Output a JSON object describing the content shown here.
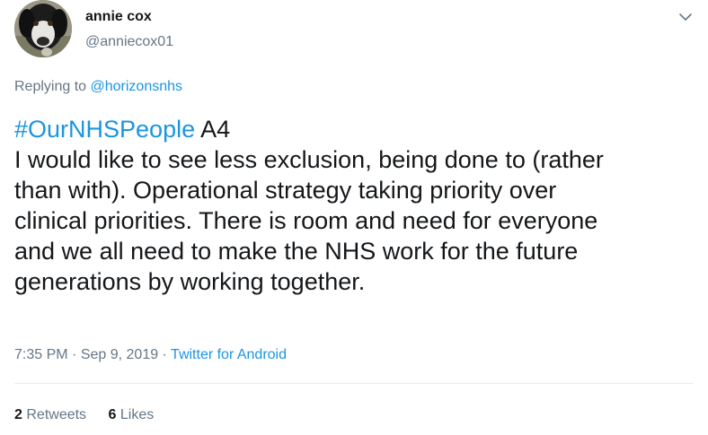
{
  "author": {
    "display_name": "annie cox",
    "handle": "@anniecox01",
    "avatar_icon": "dog-avatar"
  },
  "reply": {
    "prefix": "Replying to",
    "mention": "@horizonsnhs"
  },
  "tweet": {
    "hashtag": "#OurNHSPeople",
    "after_hashtag": " A4",
    "lines": [
      "I would like to see less exclusion, being done to (rather",
      "than with). Operational strategy taking priority over",
      "clinical priorities. There is room and need for everyone",
      "and we all need to make the NHS work for the future",
      "generations by working together."
    ]
  },
  "meta": {
    "time": "7:35 PM",
    "sep1": " · ",
    "date": "Sep 9, 2019",
    "sep2": " · ",
    "source": "Twitter for Android"
  },
  "stats": {
    "retweets_count": "2",
    "retweets_label": "Retweets",
    "likes_count": "6",
    "likes_label": "Likes"
  },
  "icons": {
    "menu": "chevron-down-icon"
  },
  "colors": {
    "link": "#1b95e0",
    "secondary_text": "#657786",
    "primary_text": "#14171a",
    "divider": "#e6ecf0"
  }
}
